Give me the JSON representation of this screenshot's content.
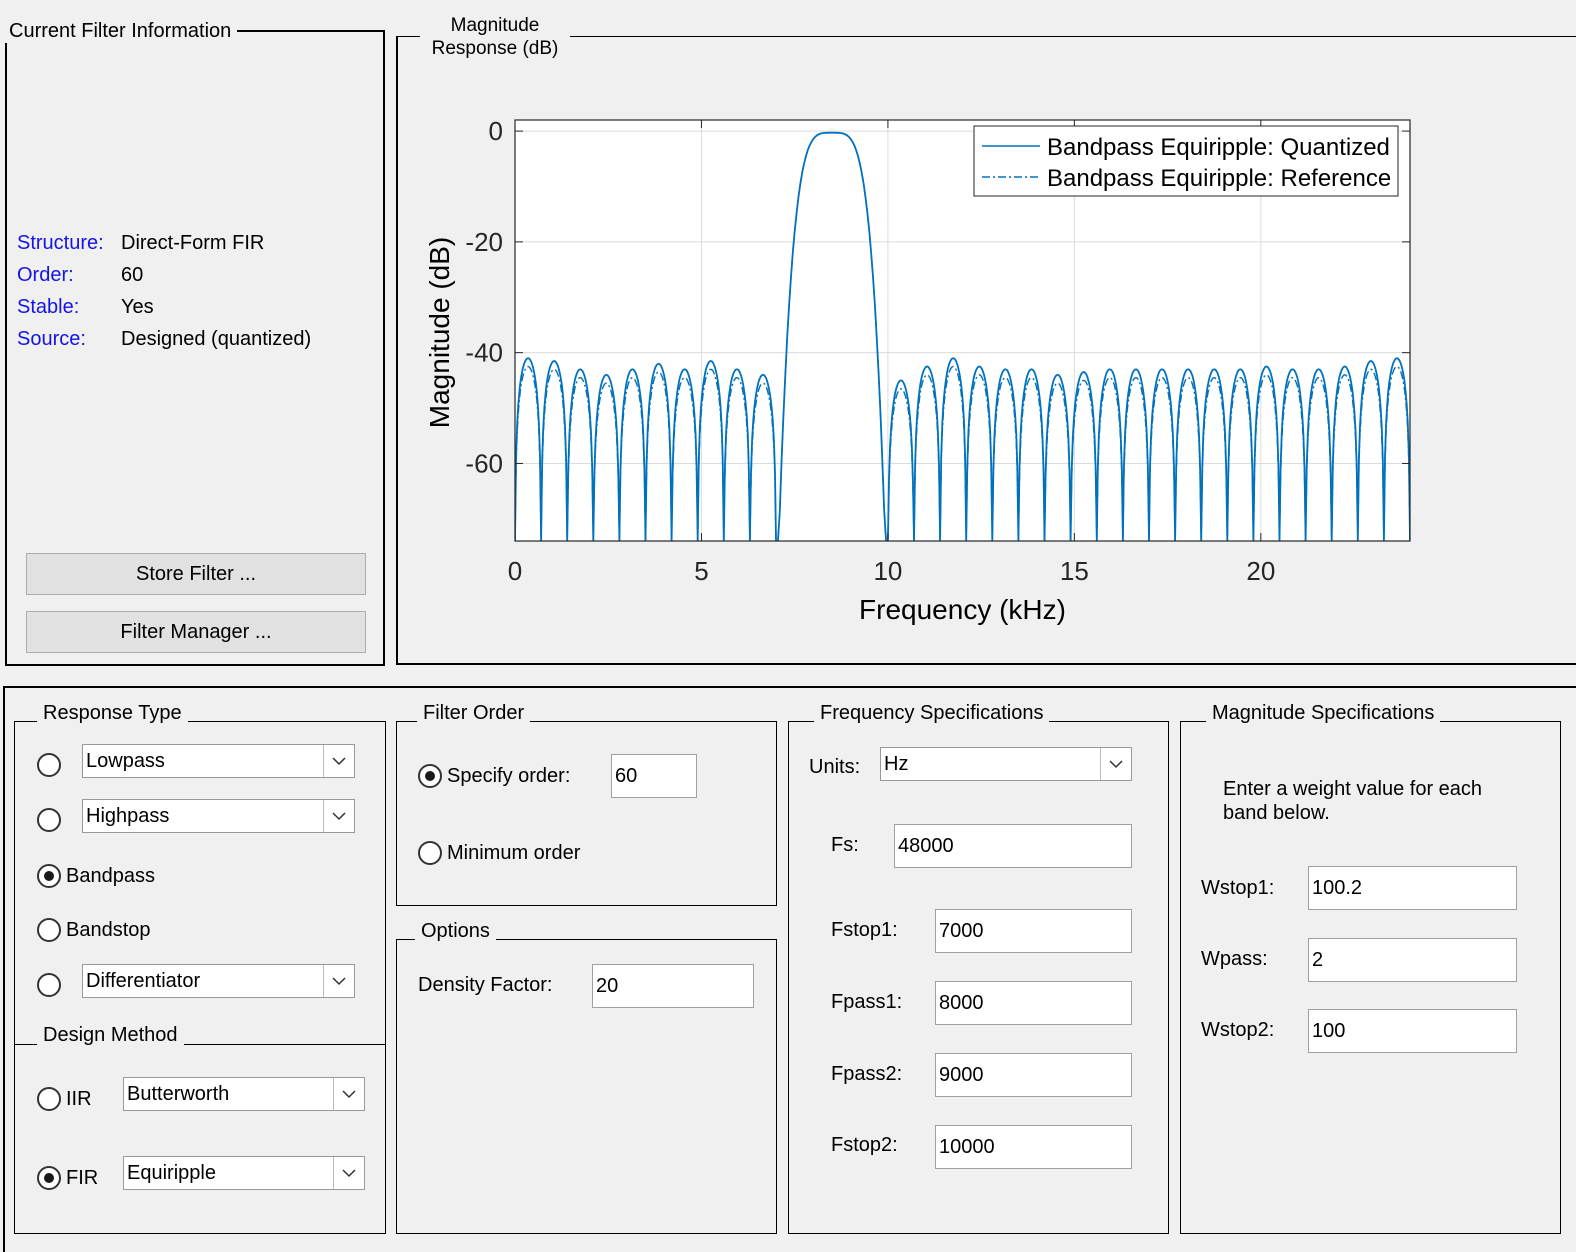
{
  "info_panel": {
    "title": "Current Filter Information",
    "rows": [
      {
        "label": "Structure:",
        "value": "Direct-Form FIR"
      },
      {
        "label": "Order:",
        "value": "60"
      },
      {
        "label": "Stable:",
        "value": "Yes"
      },
      {
        "label": "Source:",
        "value": "Designed (quantized)"
      }
    ],
    "store_button": "Store Filter ...",
    "manager_button": "Filter Manager ..."
  },
  "plot_panel": {
    "title_line1": "Magnitude",
    "title_line2": "Response (dB)"
  },
  "chart_data": {
    "type": "line",
    "xlabel": "Frequency (kHz)",
    "ylabel": "Magnitude (dB)",
    "xlim": [
      0,
      24
    ],
    "ylim": [
      -74,
      2
    ],
    "xticks": [
      "0",
      "5",
      "10",
      "15",
      "20"
    ],
    "xtick_values": [
      0,
      5,
      10,
      15,
      20
    ],
    "yticks": [
      "0",
      "-20",
      "-40",
      "-60"
    ],
    "ytick_values": [
      0,
      -20,
      -40,
      -60
    ],
    "grid": true,
    "legend_position": "top-right",
    "passband_kHz": [
      7,
      10
    ],
    "passband_peak_x": 8.5,
    "passband_peak_db": -0.3,
    "stopband_lobe_peaks_db": [
      -41,
      -41.5,
      -43,
      -44,
      -43,
      -42,
      -43,
      -41.5,
      -43,
      -44,
      -45,
      -42.5,
      -41,
      -42.5,
      -43,
      -43,
      -44,
      -43.5,
      -43,
      -43,
      -43,
      -43,
      -43,
      -43,
      -42.5,
      -43,
      -43,
      -42.5,
      -41.5,
      -41
    ],
    "series": [
      {
        "name": "Bandpass Equiripple: Quantized",
        "style": "solid",
        "color": "#0072bd"
      },
      {
        "name": "Bandpass Equiripple: Reference",
        "style": "dashdot",
        "color": "#0072bd"
      }
    ]
  },
  "response_type": {
    "title": "Response Type",
    "options": [
      {
        "label": "Lowpass",
        "selected": false,
        "has_dropdown": true
      },
      {
        "label": "Highpass",
        "selected": false,
        "has_dropdown": true
      },
      {
        "label": "Bandpass",
        "selected": true,
        "has_dropdown": false
      },
      {
        "label": "Bandstop",
        "selected": false,
        "has_dropdown": false
      },
      {
        "label": "Differentiator",
        "selected": false,
        "has_dropdown": true
      }
    ]
  },
  "design_method": {
    "title": "Design Method",
    "iir_label": "IIR",
    "iir_value": "Butterworth",
    "fir_label": "FIR",
    "fir_value": "Equiripple",
    "selected": "FIR"
  },
  "filter_order": {
    "title": "Filter Order",
    "specify_label": "Specify order:",
    "specify_value": "60",
    "minimum_label": "Minimum order",
    "selected": "specify"
  },
  "options": {
    "title": "Options",
    "density_label": "Density Factor:",
    "density_value": "20"
  },
  "freq_specs": {
    "title": "Frequency Specifications",
    "units_label": "Units:",
    "units_value": "Hz",
    "fields": [
      {
        "label": "Fs:",
        "value": "48000"
      },
      {
        "label": "Fstop1:",
        "value": "7000"
      },
      {
        "label": "Fpass1:",
        "value": "8000"
      },
      {
        "label": "Fpass2:",
        "value": "9000"
      },
      {
        "label": "Fstop2:",
        "value": "10000"
      }
    ]
  },
  "mag_specs": {
    "title": "Magnitude Specifications",
    "instruction_line1": "Enter a weight value for each",
    "instruction_line2": "band below.",
    "fields": [
      {
        "label": "Wstop1:",
        "value": "100.2"
      },
      {
        "label": "Wpass:",
        "value": "2"
      },
      {
        "label": "Wstop2:",
        "value": "100"
      }
    ]
  },
  "colors": {
    "background": "#f0f0f0",
    "info_label": "#1414e6",
    "line": "#0072bd",
    "grid": "#dcdcdc"
  }
}
